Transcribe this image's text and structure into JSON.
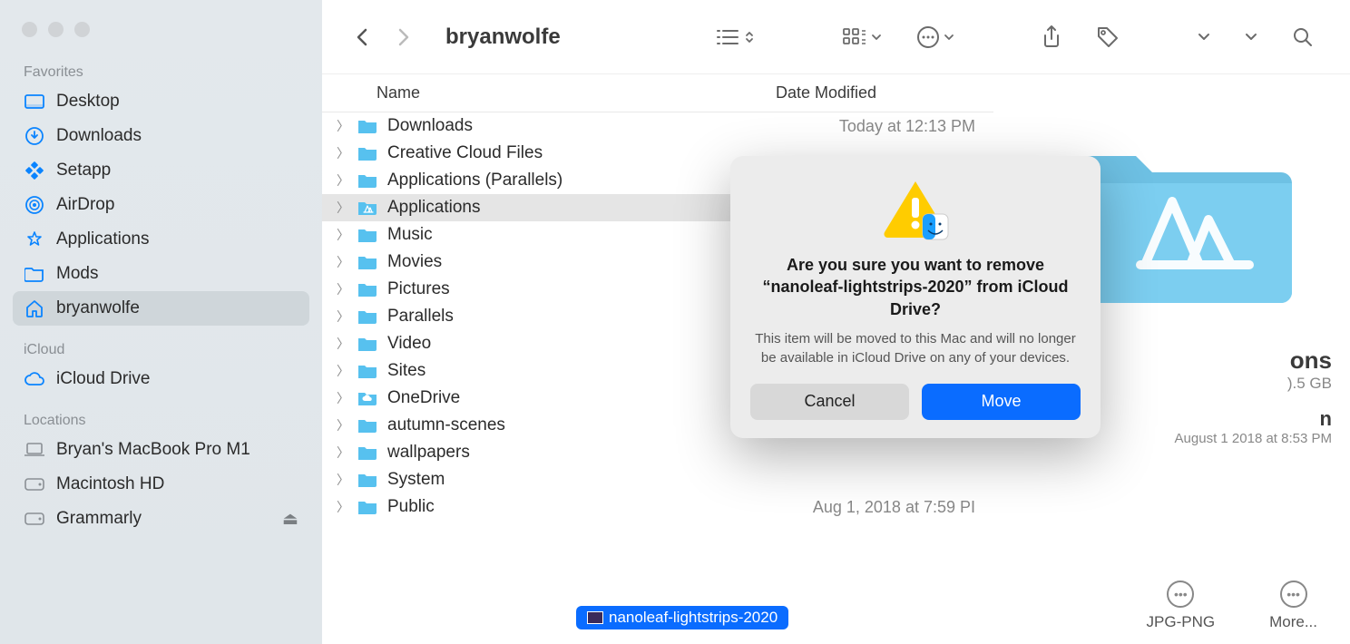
{
  "window_title": "bryanwolfe",
  "sidebar": {
    "sections": [
      {
        "label": "Favorites",
        "items": [
          {
            "icon": "desktop-icon",
            "label": "Desktop"
          },
          {
            "icon": "downloads-icon",
            "label": "Downloads"
          },
          {
            "icon": "setapp-icon",
            "label": "Setapp"
          },
          {
            "icon": "airdrop-icon",
            "label": "AirDrop"
          },
          {
            "icon": "applications-icon",
            "label": "Applications"
          },
          {
            "icon": "folder-icon",
            "label": "Mods"
          },
          {
            "icon": "home-icon",
            "label": "bryanwolfe",
            "selected": true
          }
        ]
      },
      {
        "label": "iCloud",
        "items": [
          {
            "icon": "cloud-icon",
            "label": "iCloud Drive"
          }
        ]
      },
      {
        "label": "Locations",
        "items": [
          {
            "icon": "laptop-icon",
            "label": "Bryan's MacBook Pro M1"
          },
          {
            "icon": "disk-icon",
            "label": "Macintosh HD"
          },
          {
            "icon": "disk-icon",
            "label": "Grammarly",
            "eject": true
          }
        ]
      }
    ]
  },
  "columns": {
    "name": "Name",
    "date": "Date Modified"
  },
  "rows": [
    {
      "name": "Downloads",
      "date": "Today at 12:13 PM"
    },
    {
      "name": "Creative Cloud Files",
      "date": ""
    },
    {
      "name": "Applications (Parallels)",
      "date": ""
    },
    {
      "name": "Applications",
      "date": "",
      "selected": true,
      "apps": true
    },
    {
      "name": "Music",
      "date": ""
    },
    {
      "name": "Movies",
      "date": ""
    },
    {
      "name": "Pictures",
      "date": ""
    },
    {
      "name": "Parallels",
      "date": ""
    },
    {
      "name": "Video",
      "date": ""
    },
    {
      "name": "Sites",
      "date": ""
    },
    {
      "name": "OneDrive",
      "date": "",
      "cloud": true
    },
    {
      "name": "autumn-scenes",
      "date": ""
    },
    {
      "name": "wallpapers",
      "date": ""
    },
    {
      "name": "System",
      "date": ""
    },
    {
      "name": "Public",
      "date": "Aug 1, 2018 at 7:59 PI"
    }
  ],
  "drag_item": "nanoleaf-lightstrips-2020",
  "preview": {
    "title_suffix": "ons",
    "size_suffix": ").5 GB",
    "n_suffix": "n",
    "date_suffix": "August 1  2018 at 8:53 PM"
  },
  "quick_actions": [
    {
      "label": "JPG-PNG"
    },
    {
      "label": "More..."
    }
  ],
  "dialog": {
    "title": "Are you sure you want to remove “nanoleaf-lightstrips-2020” from iCloud Drive?",
    "body": "This item will be moved to this Mac and will no longer be available in iCloud Drive on any of your devices.",
    "cancel": "Cancel",
    "move": "Move"
  }
}
